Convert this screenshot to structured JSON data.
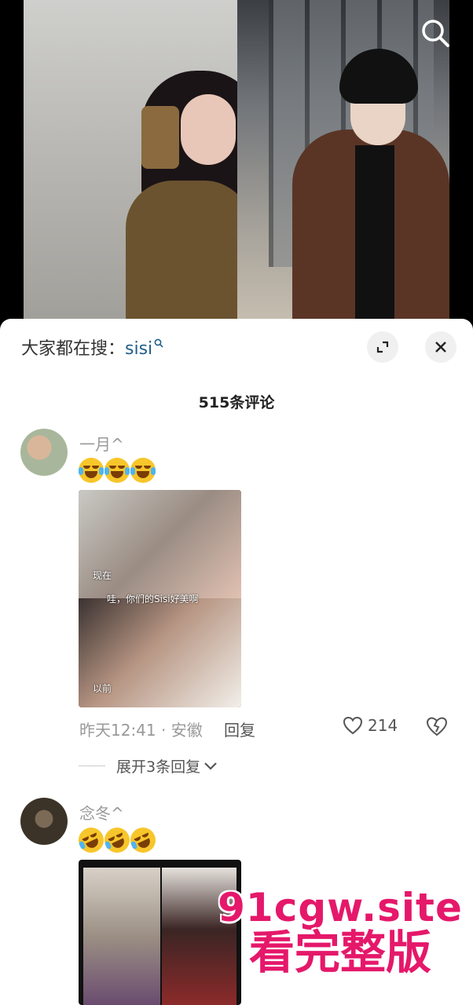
{
  "panel": {
    "hot_search_prefix": "大家都在搜：",
    "hot_search_keyword": "sisi",
    "comment_count": "515条评论"
  },
  "comments": [
    {
      "username": "一月^",
      "emojis": [
        "laugh-cry",
        "laugh-cry",
        "laugh-cry"
      ],
      "photo_captions": [
        "现在",
        "哇，你们的Sisi好美啊",
        "以前"
      ],
      "time_location": "昨天12:41 · 安徽",
      "reply_label": "回复",
      "likes": "214",
      "expand_replies": "展开3条回复"
    },
    {
      "username": "念冬^",
      "emojis": [
        "rofl",
        "rofl",
        "rofl"
      ]
    }
  ],
  "watermark": {
    "line1": "91cgw.site",
    "line2": "看完整版"
  },
  "colors": {
    "keyword": "#1f5e8a",
    "watermark": "#e5186a",
    "emoji": "#f7c62b"
  }
}
